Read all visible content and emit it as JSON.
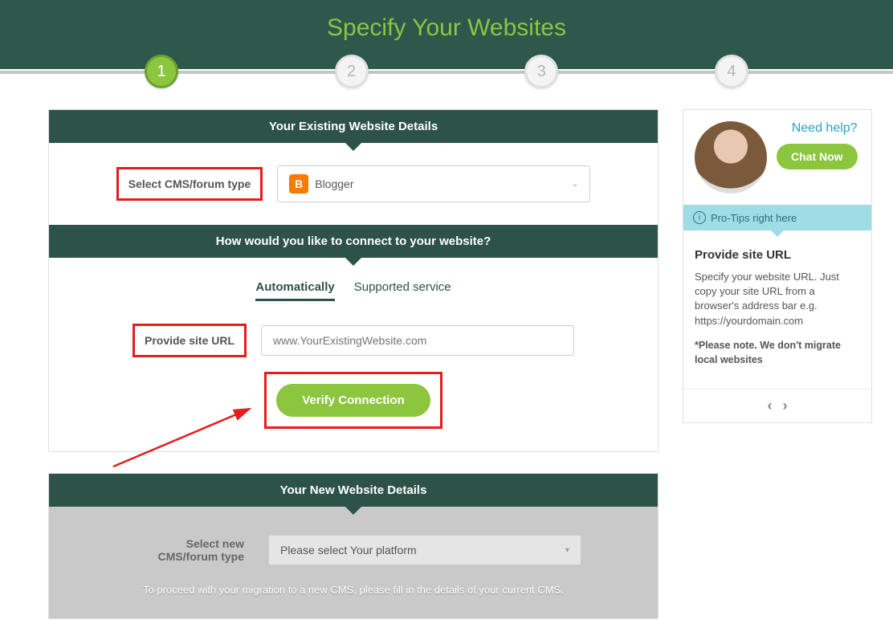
{
  "hero": {
    "title": "Specify Your Websites"
  },
  "steps": [
    "1",
    "2",
    "3",
    "4"
  ],
  "existingPanel": {
    "header": "Your Existing Website Details",
    "cmsLabel": "Select CMS/forum type",
    "cmsValue": "Blogger",
    "connectHeader": "How would you like to connect to your website?",
    "tabAuto": "Automatically",
    "tabSupported": "Supported service",
    "urlLabel": "Provide site URL",
    "urlPlaceholder": "www.YourExistingWebsite.com",
    "verifyLabel": "Verify Connection"
  },
  "newPanel": {
    "header": "Your New Website Details",
    "cmsLabel": "Select new CMS/forum type",
    "placeholder": "Please select Your platform",
    "note": "To proceed with your migration to a new CMS, please fill in the details of your current CMS."
  },
  "help": {
    "needHelp": "Need help?",
    "chatNow": "Chat Now",
    "tipsLabel": "Pro-Tips right here",
    "tipTitle": "Provide site URL",
    "tipBody": "Specify your website URL. Just copy your site URL from a browser's address bar e.g. https://yourdomain.com",
    "tipNote": "*Please note. We don't migrate local websites"
  }
}
